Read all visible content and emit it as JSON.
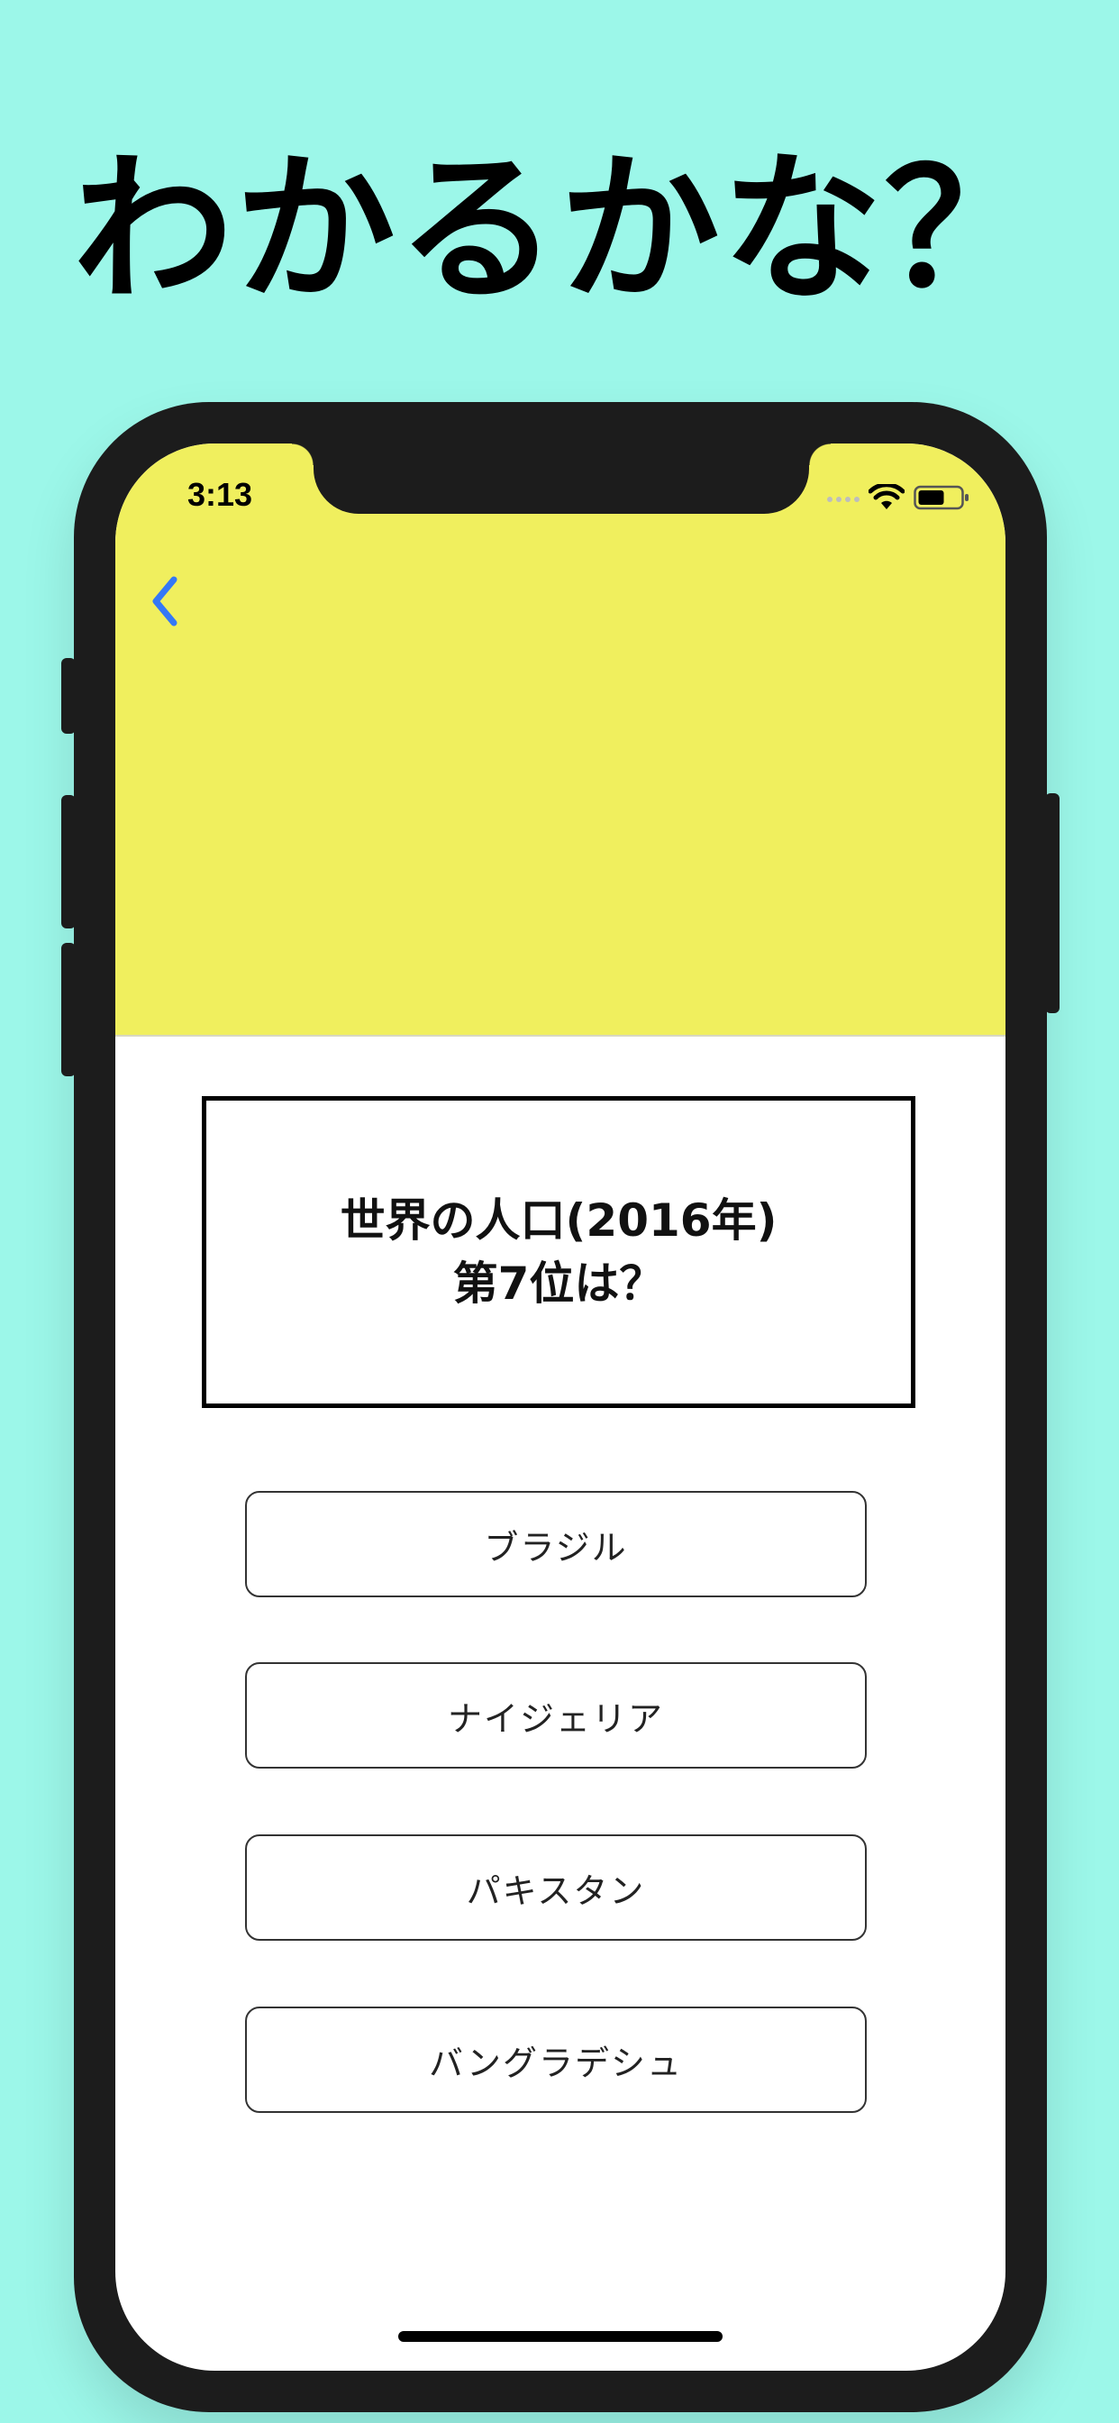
{
  "promo": {
    "headline": "わかるかな？"
  },
  "status_bar": {
    "time": "3:13"
  },
  "nav": {
    "back_icon": "chevron-left-icon",
    "back_color": "#3478f6"
  },
  "question": {
    "line1": "世界の人口(2016年)",
    "line2": "第7位は？"
  },
  "options": [
    {
      "label": "ブラジル"
    },
    {
      "label": "ナイジェリア"
    },
    {
      "label": "パキスタン"
    },
    {
      "label": "バングラデシュ"
    }
  ],
  "colors": {
    "background": "#9cf7e9",
    "navbar": "#f0ef5e",
    "phone_frame": "#1c1c1c"
  }
}
